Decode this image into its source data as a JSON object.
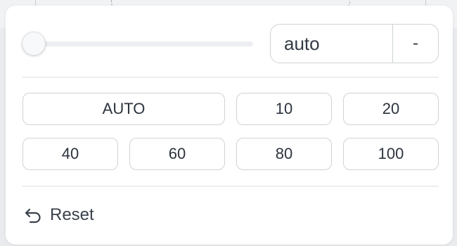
{
  "slider": {
    "value_fraction": 0.0
  },
  "value_field": {
    "value": "auto",
    "unit": "-"
  },
  "presets": {
    "row1": [
      "AUTO",
      "10",
      "20"
    ],
    "row2": [
      "40",
      "60",
      "80",
      "100"
    ]
  },
  "reset": {
    "label": "Reset",
    "icon": "undo-arrow-icon"
  },
  "colors": {
    "panel_bg": "#ffffff",
    "border": "#cfd3d8",
    "text": "#2c333d",
    "backdrop": "#e9ebee"
  }
}
